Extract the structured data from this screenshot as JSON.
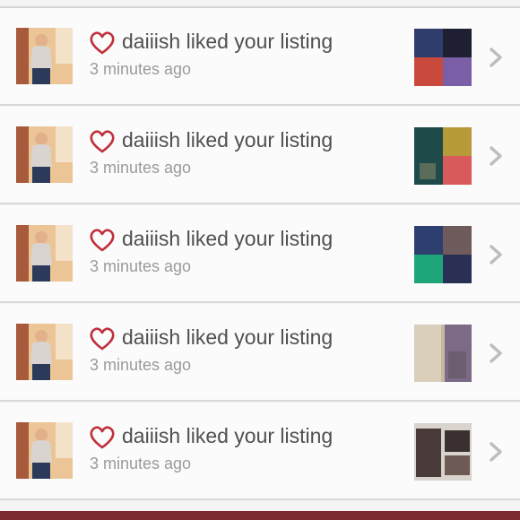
{
  "notifications": [
    {
      "message": "daiiish liked your listing",
      "time": "3 minutes ago",
      "thumb_colors": [
        "#2e3d6b",
        "#1e1f33",
        "#c94a3d",
        "#7a5fa6"
      ]
    },
    {
      "message": "daiiish liked your listing",
      "time": "3 minutes ago",
      "thumb_colors": [
        "#1f4a4a",
        "#b79a3a",
        "#5b6d5a",
        "#d85a5a"
      ]
    },
    {
      "message": "daiiish liked your listing",
      "time": "3 minutes ago",
      "thumb_colors": [
        "#2c3f6e",
        "#6f5b5b",
        "#1fa57a",
        "#2a3054"
      ]
    },
    {
      "message": "daiiish liked your listing",
      "time": "3 minutes ago",
      "thumb_colors": [
        "#d9cfbb",
        "#7c6a86",
        "#c8b8a0",
        "#6a5e70"
      ]
    },
    {
      "message": "daiiish liked your listing",
      "time": "3 minutes ago",
      "thumb_colors": [
        "#4a3b3a",
        "#3a3030",
        "#6d5a55",
        "#d8d3cc"
      ]
    }
  ],
  "icons": {
    "like": "heart-icon",
    "open": "chevron-right-icon",
    "avatar": "user-avatar"
  },
  "colors": {
    "heart": "#c0303d",
    "chevron": "#bdbdbd",
    "title": "#4f4f4f",
    "time": "#9a9a9a",
    "footer": "#7c2b31"
  }
}
